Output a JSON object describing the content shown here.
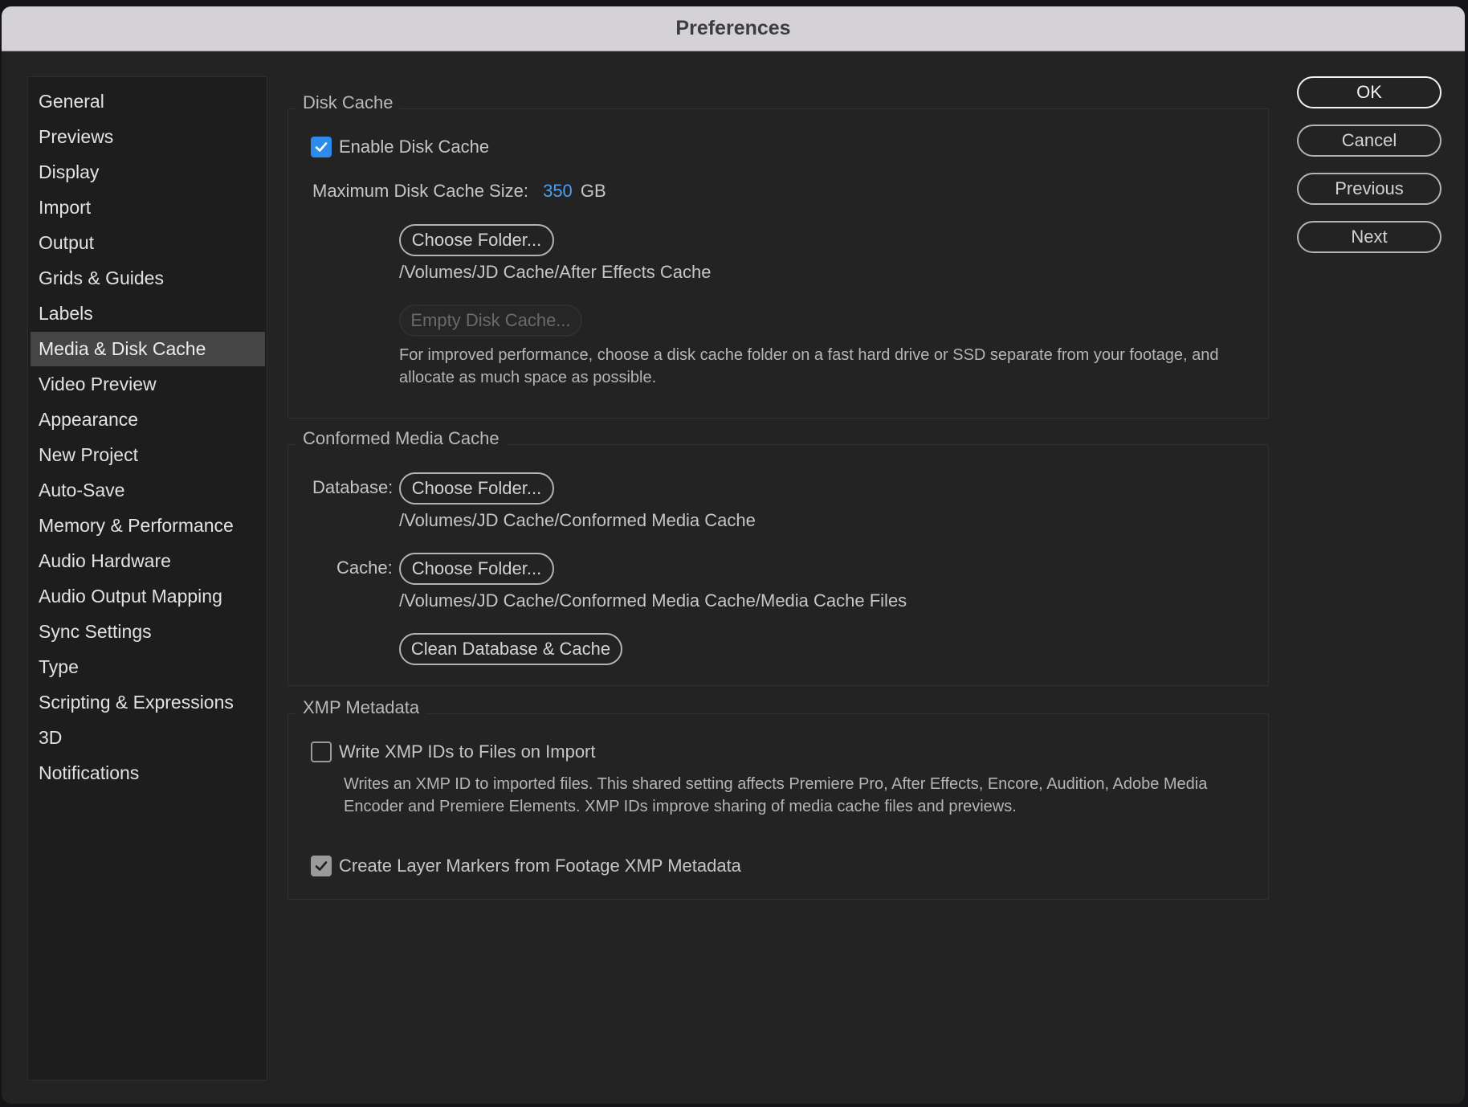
{
  "window": {
    "title": "Preferences"
  },
  "sidebar": {
    "items": [
      {
        "label": "General"
      },
      {
        "label": "Previews"
      },
      {
        "label": "Display"
      },
      {
        "label": "Import"
      },
      {
        "label": "Output"
      },
      {
        "label": "Grids & Guides"
      },
      {
        "label": "Labels"
      },
      {
        "label": "Media & Disk Cache",
        "selected": true
      },
      {
        "label": "Video Preview"
      },
      {
        "label": "Appearance"
      },
      {
        "label": "New Project"
      },
      {
        "label": "Auto-Save"
      },
      {
        "label": "Memory & Performance"
      },
      {
        "label": "Audio Hardware"
      },
      {
        "label": "Audio Output Mapping"
      },
      {
        "label": "Sync Settings"
      },
      {
        "label": "Type"
      },
      {
        "label": "Scripting & Expressions"
      },
      {
        "label": "3D"
      },
      {
        "label": "Notifications"
      }
    ]
  },
  "disk_cache": {
    "title": "Disk Cache",
    "enable_label": "Enable Disk Cache",
    "enable_checked": true,
    "max_size_label": "Maximum Disk Cache Size:",
    "max_size_value": "350",
    "max_size_unit": "GB",
    "choose_folder_label": "Choose Folder...",
    "folder_path": "/Volumes/JD Cache/After Effects Cache",
    "empty_cache_label": "Empty Disk Cache...",
    "hint_line1": "For improved performance, choose a disk cache folder on a fast hard drive or SSD separate from your footage, and",
    "hint_line2": "allocate as much space as possible."
  },
  "conformed_media_cache": {
    "title": "Conformed Media Cache",
    "database_label": "Database:",
    "database_button": "Choose Folder...",
    "database_path": "/Volumes/JD Cache/Conformed Media Cache",
    "cache_label": "Cache:",
    "cache_button": "Choose Folder...",
    "cache_path": "/Volumes/JD Cache/Conformed Media Cache/Media Cache Files",
    "clean_label": "Clean Database & Cache"
  },
  "xmp_metadata": {
    "title": "XMP Metadata",
    "write_ids_label": "Write XMP IDs to Files on Import",
    "write_ids_checked": false,
    "write_ids_hint_line1": "Writes an XMP ID to imported files. This shared setting affects Premiere Pro, After Effects, Encore, Audition, Adobe Media",
    "write_ids_hint_line2": "Encoder and Premiere Elements. XMP IDs improve sharing of media cache files and previews.",
    "layer_markers_label": "Create Layer Markers from Footage XMP Metadata",
    "layer_markers_checked": true
  },
  "actions": {
    "ok": "OK",
    "cancel": "Cancel",
    "previous": "Previous",
    "next": "Next"
  },
  "colors": {
    "accent_blue": "#2d8ceb",
    "value_blue": "#4aa0f0"
  }
}
